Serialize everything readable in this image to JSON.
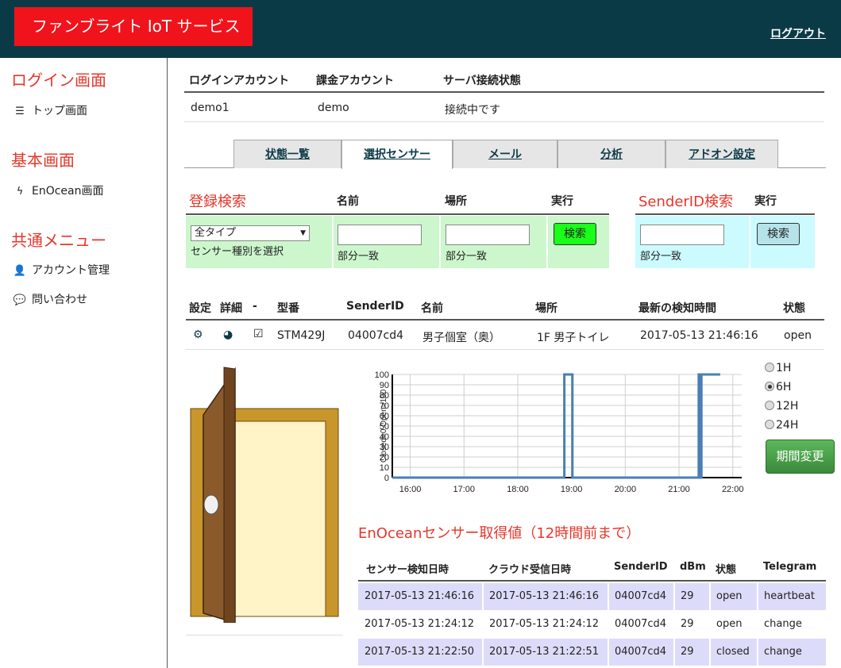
{
  "header": {
    "brand": "ファンブライト IoT サービス",
    "logout": "ログアウト"
  },
  "sidebar": {
    "sections": [
      {
        "title": "ログイン画面",
        "items": [
          {
            "icon": "menu-icon",
            "label": "トップ画面"
          }
        ]
      },
      {
        "title": "基本画面",
        "items": [
          {
            "icon": "bolt-icon",
            "label": "EnOcean画面"
          }
        ]
      },
      {
        "title": "共通メニュー",
        "items": [
          {
            "icon": "user-icon",
            "label": "アカウント管理"
          },
          {
            "icon": "chat-icon",
            "label": "問い合わせ"
          }
        ]
      }
    ]
  },
  "account": {
    "headers": [
      "ログインアカウント",
      "課金アカウント",
      "サーバ接続状態"
    ],
    "values": [
      "demo1",
      "demo",
      "接続中です"
    ]
  },
  "tabs": [
    {
      "label": "状態一覧",
      "active": false
    },
    {
      "label": "選択センサー",
      "active": true
    },
    {
      "label": "メール",
      "active": false
    },
    {
      "label": "分析",
      "active": false
    },
    {
      "label": "アドオン設定",
      "active": false
    }
  ],
  "search": {
    "title": "登録検索",
    "name_header": "名前",
    "place_header": "場所",
    "exec_header": "実行",
    "type_select": "全タイプ",
    "type_hint": "センサー種別を選択",
    "name_hint": "部分一致",
    "place_hint": "部分一致",
    "search_button": "検索",
    "sender_title": "SenderID検索",
    "sender_exec_header": "実行",
    "sender_hint": "部分一致",
    "sender_button": "検索"
  },
  "sensor_table": {
    "headers": [
      "設定",
      "詳細",
      "-",
      "型番",
      "SenderID",
      "名前",
      "場所",
      "最新の検知時間",
      "状態"
    ],
    "row": {
      "model": "STM429J",
      "sender_id": "04007cd4",
      "name": "男子個室（奥）",
      "place": "1F 男子トイレ",
      "last_detect": "2017-05-13 21:46:16",
      "state": "open"
    }
  },
  "chart_data": {
    "type": "line",
    "ylabel": "Closed=0 Open=100",
    "ylim": [
      0,
      100
    ],
    "yticks": [
      0,
      10,
      20,
      30,
      40,
      50,
      60,
      70,
      80,
      90,
      100
    ],
    "xlim": [
      "15:40",
      "22:10"
    ],
    "xticks": [
      "16:00",
      "17:00",
      "18:00",
      "19:00",
      "20:00",
      "21:00",
      "22:00"
    ],
    "grid": true,
    "series": [
      {
        "color": "#4a7fb5",
        "x": [
          "15:40",
          "18:52",
          "18:52",
          "19:01",
          "19:01",
          "21:22",
          "21:22",
          "21:24",
          "21:24",
          "21:25",
          "21:25",
          "21:46"
        ],
        "values": [
          0,
          0,
          100,
          100,
          0,
          0,
          100,
          100,
          0,
          0,
          100,
          100
        ]
      }
    ]
  },
  "period": {
    "options": [
      {
        "label": "1H",
        "selected": false
      },
      {
        "label": "6H",
        "selected": true
      },
      {
        "label": "12H",
        "selected": false
      },
      {
        "label": "24H",
        "selected": false
      }
    ],
    "button": "期間変更"
  },
  "history": {
    "title": "EnOceanセンサー取得値（12時間前まで）",
    "headers": [
      "センサー検知日時",
      "クラウド受信日時",
      "SenderID",
      "dBm",
      "状態",
      "Telegram"
    ],
    "rows": [
      [
        "2017-05-13 21:46:16",
        "2017-05-13 21:46:16",
        "04007cd4",
        "29",
        "open",
        "heartbeat"
      ],
      [
        "2017-05-13 21:24:12",
        "2017-05-13 21:24:12",
        "04007cd4",
        "29",
        "open",
        "change"
      ],
      [
        "2017-05-13 21:22:50",
        "2017-05-13 21:22:51",
        "04007cd4",
        "29",
        "closed",
        "change"
      ]
    ]
  },
  "colors": {
    "header_bg": "#0b3a47",
    "brand_bg": "#f0131b",
    "accent_red": "#e4372b",
    "search_green": "#ccf7cc",
    "search_cyan": "#ccfbff",
    "row_highlight": "#dcdcfa",
    "chart_line": "#4a7fb5"
  }
}
